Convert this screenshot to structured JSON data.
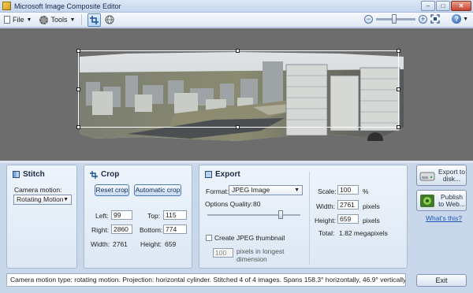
{
  "window": {
    "title": "Microsoft Image Composite Editor"
  },
  "toolbar": {
    "file_label": "File",
    "tools_label": "Tools",
    "zoom_fraction": 0.45
  },
  "stitch": {
    "title": "Stitch",
    "camera_motion_label": "Camera motion:",
    "camera_motion_value": "Rotating Motion"
  },
  "crop": {
    "title": "Crop",
    "reset_label": "Reset crop",
    "auto_label": "Automatic crop",
    "left_label": "Left:",
    "left_value": "99",
    "top_label": "Top:",
    "top_value": "115",
    "right_label": "Right:",
    "right_value": "2860",
    "bottom_label": "Bottom:",
    "bottom_value": "774",
    "width_label": "Width:",
    "width_value": "2761",
    "height_label": "Height:",
    "height_value": "659"
  },
  "export": {
    "title": "Export",
    "format_label": "Format:",
    "format_value": "JPEG Image",
    "quality_label": "Options Quality:",
    "quality_value": "80",
    "quality_fraction": 0.8,
    "thumbnail_label": "Create JPEG thumbnail",
    "thumb_size_value": "100",
    "thumb_size_hint": "pixels in longest dimension",
    "scale_label": "Scale:",
    "scale_value": "100",
    "scale_unit": "%",
    "width_label": "Width:",
    "width_value": "2761",
    "width_unit": "pixels",
    "height_label": "Height:",
    "height_value": "659",
    "height_unit": "pixels",
    "total_label": "Total:",
    "total_value": "1.82 megapixels"
  },
  "actions": {
    "export_disk_label": "Export to disk...",
    "publish_web_label": "Publish to Web...",
    "whats_this_label": "What's this?",
    "exit_label": "Exit"
  },
  "status": {
    "text": "Camera motion type: rotating motion. Projection: horizontal cylinder. Stitched 4 of 4 images. Spans 158.3° horizontally, 46.9° vertically."
  },
  "colors": {
    "canvas_bg": "#6d6d6d",
    "panel_bg": "#dde8f5",
    "accent": "#4e79b5"
  }
}
